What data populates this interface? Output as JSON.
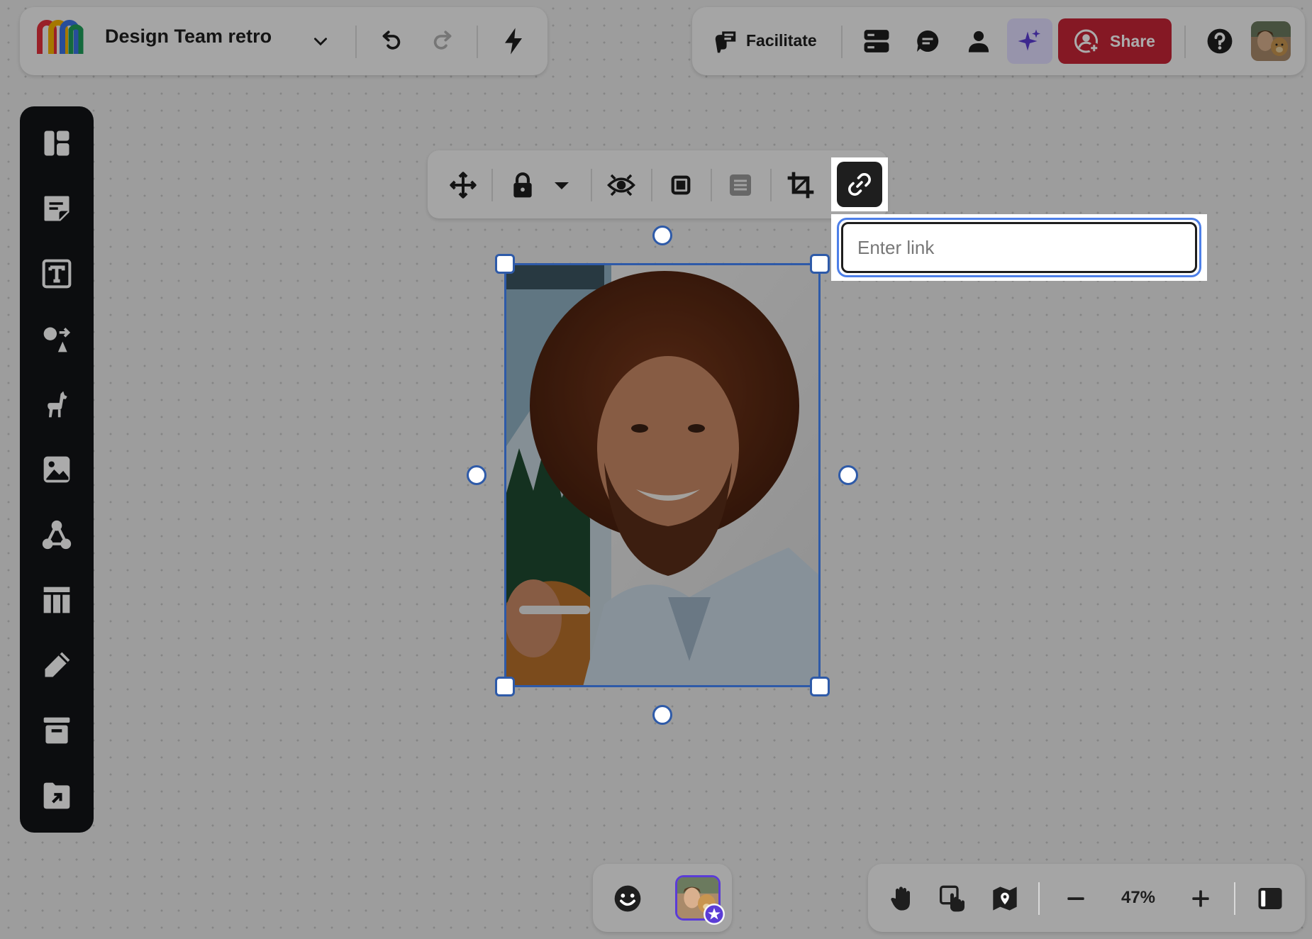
{
  "header": {
    "board_title": "Design Team retro",
    "icons": [
      "miro-logo",
      "chevron-down-icon",
      "undo-icon",
      "redo-icon",
      "lightning-icon"
    ]
  },
  "topbar": {
    "facilitate_label": "Facilitate",
    "share_label": "Share",
    "icons": [
      "facilitate-icon",
      "board-list-icon",
      "comment-icon",
      "user-icon",
      "ai-sparkle-icon",
      "add-user-icon",
      "help-icon",
      "avatar"
    ]
  },
  "left_toolbar": {
    "tools": [
      "templates",
      "sticky-note",
      "text",
      "shapes",
      "apps",
      "image",
      "diagram",
      "table",
      "pen",
      "frame",
      "upload"
    ]
  },
  "context_toolbar": {
    "tools": [
      "move",
      "lock",
      "lock-dropdown",
      "hide",
      "border",
      "text-align",
      "crop",
      "link"
    ]
  },
  "link_popup": {
    "placeholder": "Enter link",
    "value": ""
  },
  "bottom": {
    "zoom_level": "47%",
    "icons": [
      "emoji-icon",
      "collaborator-avatar",
      "hand-icon",
      "touch-icon",
      "map-pin-icon",
      "zoom-out-icon",
      "zoom-in-icon",
      "panel-icon"
    ]
  },
  "colors": {
    "share": "#c62436",
    "accent_purple": "#5b3cd6",
    "selection": "#2e5aa8",
    "focus": "#4d7fe8",
    "toolbar_dark": "#121417"
  }
}
